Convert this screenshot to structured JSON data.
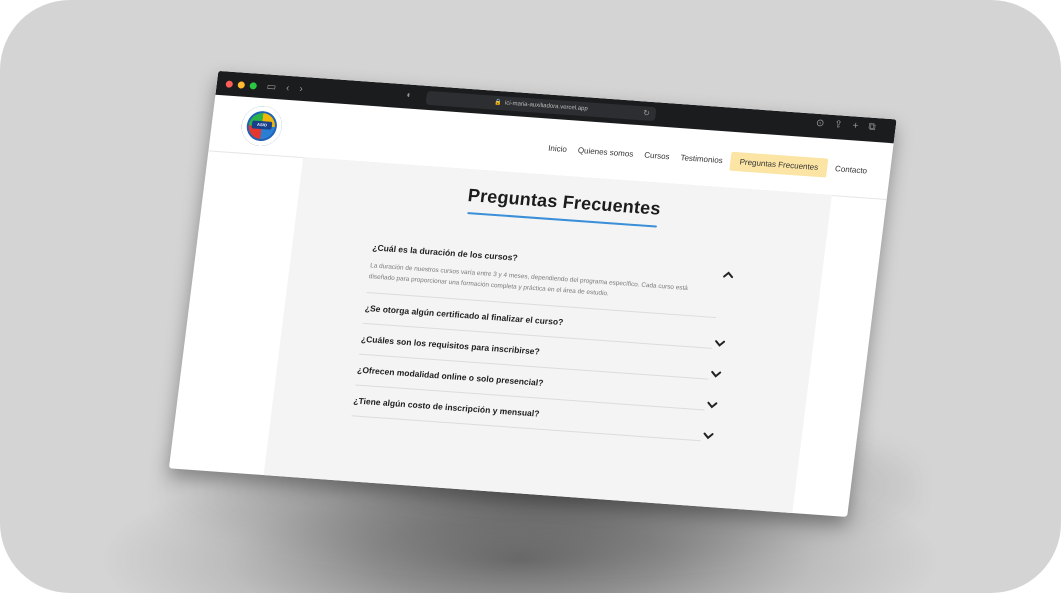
{
  "browser": {
    "url": "ici-maria-auxiliadora.vercel.app"
  },
  "nav": {
    "logo_text": "ASIO",
    "items": [
      {
        "label": "Inicio"
      },
      {
        "label": "Quienes somos"
      },
      {
        "label": "Cursos"
      },
      {
        "label": "Testimonios"
      },
      {
        "label": "Preguntas Frecuentes",
        "active": true
      },
      {
        "label": "Contacto"
      }
    ]
  },
  "faq": {
    "title": "Preguntas Frecuentes",
    "items": [
      {
        "question": "¿Cuál es la duración de los cursos?",
        "answer": "La duración de nuestros cursos varía entre 3 y 4 meses, dependiendo del programa específico. Cada curso está diseñado para proporcionar una formación completa y práctica en el área de estudio.",
        "open": true
      },
      {
        "question": "¿Se otorga algún certificado al finalizar el curso?"
      },
      {
        "question": "¿Cuáles son los requisitos para inscribirse?"
      },
      {
        "question": "¿Ofrecen modalidad online o solo presencial?"
      },
      {
        "question": "¿Tiene algún costo de inscripción y mensual?"
      }
    ]
  },
  "colors": {
    "accent": "#3a8fd8",
    "active_nav_bg": "#fbe4a4",
    "chrome": "#1b1c1e"
  }
}
